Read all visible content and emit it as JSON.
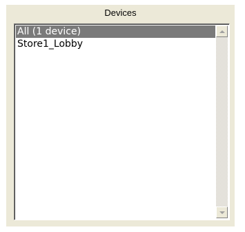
{
  "panel": {
    "title": "Devices"
  },
  "devices_list": {
    "items": [
      {
        "label": "All (1 device)",
        "selected": true
      },
      {
        "label": "Store1_Lobby",
        "selected": false
      }
    ]
  },
  "scrollbar": {
    "up_icon": "triangle-up",
    "down_icon": "triangle-down"
  },
  "colors": {
    "panel_bg": "#ece9d8",
    "selection_bg": "#7a7a7a",
    "selection_text": "#ffffff"
  }
}
